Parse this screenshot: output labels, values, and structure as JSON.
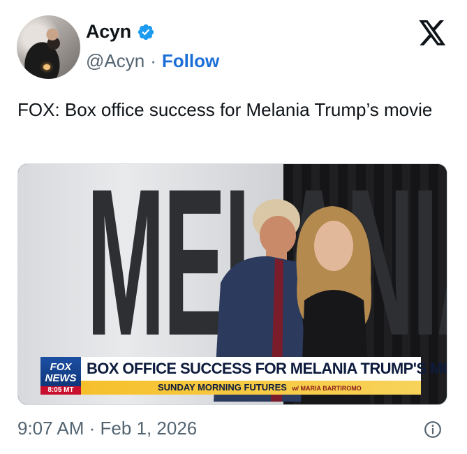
{
  "author": {
    "name": "Acyn",
    "handle": "@Acyn",
    "separator": "·",
    "follow_label": "Follow"
  },
  "tweet": {
    "text": "FOX: Box office success for Melania Trump’s movie"
  },
  "media": {
    "chyron_headline": "BOX OFFICE SUCCESS FOR MELANIA TRUMP'S MOVIE",
    "chyron_show": "SUNDAY MORNING FUTURES",
    "chyron_host": "w/ MARIA BARTIROMO",
    "logo_line1": "FOX",
    "logo_line2": "NEWS",
    "logo_time": "8:05 MT",
    "wall_letters": "MELANIA"
  },
  "footer": {
    "timestamp": "9:07 AM · Feb 1, 2026"
  },
  "icons": {
    "verified": "verified-badge-icon",
    "x_logo": "x-logo-icon",
    "info": "info-icon"
  },
  "colors": {
    "follow": "#1d6fd8",
    "verified": "#1d9bf0",
    "muted": "#536471"
  }
}
